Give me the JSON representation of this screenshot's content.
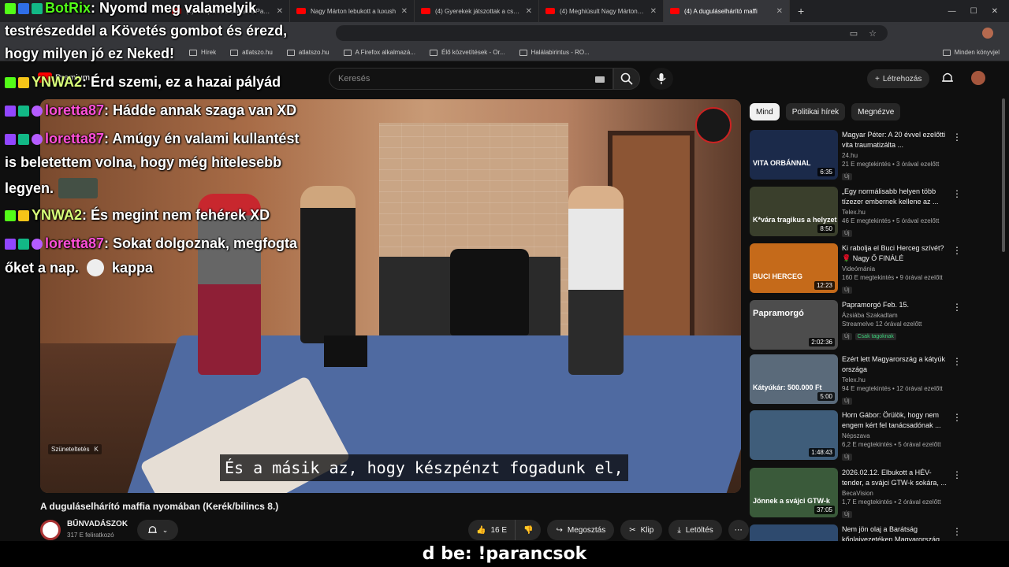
{
  "browser": {
    "tabs": [
      {
        "title": "(4) Küldj erős baloldalt a Parlam",
        "active": false
      },
      {
        "title": "Nagy Márton lebukott a luxush",
        "active": false
      },
      {
        "title": "(4) Gyerekek játszottak a csato",
        "active": false
      },
      {
        "title": "(4) Meghiúsult Nagy Márton Lu",
        "active": false
      },
      {
        "title": "(4) A duguláselhárító maffi",
        "active": true
      }
    ],
    "bookmarks": [
      "Hírek",
      "atlatszo.hu",
      "atlatszo.hu",
      "A Firefox alkalmazá...",
      "Élő közvetítések - Or...",
      "Halálabirintus - RO..."
    ],
    "bookmarks_right": "Minden könyvjel"
  },
  "youtube": {
    "logo_label": "Premium",
    "search_placeholder": "Keresés",
    "create_label": "Létrehozás"
  },
  "video": {
    "subtitle": "És a másik az, hogy készpénzt fogadunk el,",
    "pause_label": "Szüneteltetés",
    "pause_key": "K",
    "title": "A duguláselhárító maffia nyomában (Kerék/bilincs 8.)",
    "channel": "BŰNVADÁSZOK",
    "subscribers": "317 E feliratkozó",
    "likes": "16 E",
    "share_label": "Megosztás",
    "clip_label": "Klip",
    "download_label": "Letöltés"
  },
  "chips": [
    "Mind",
    "Politikai hírek",
    "Megnézve"
  ],
  "recommendations": [
    {
      "title": "Magyar Péter: A 20 évvel ezelőtti vita traumatizálta ...",
      "channel": "24.hu",
      "meta": "21 E megtekintés • 3 órával ezelőtt",
      "badge": "Új",
      "duration": "6:35",
      "thumb_text": "VITA ORBÁNNAL",
      "thumb_color": "#1b2a4a"
    },
    {
      "title": "„Egy normálisabb helyen több tízezer embernek kellene az ...",
      "channel": "Telex.hu",
      "meta": "46 E megtekintés • 5 órával ezelőtt",
      "badge": "Új",
      "duration": "8:50",
      "thumb_text": "K*vára tragikus a helyzet",
      "thumb_color": "#3a3f2c"
    },
    {
      "title": "Ki rabolja el Buci Herceg szívét? 🌹 Nagy Ő FINÁLÉ",
      "channel": "Videómánia",
      "meta": "160 E megtekintés • 9 órával ezelőtt",
      "badge": "Új",
      "duration": "12:23",
      "thumb_text": "BUCI HERCEG",
      "thumb_color": "#c56a1a"
    },
    {
      "title": "Papramorgó Feb. 15.",
      "channel": "Ázsiába Szakadtam",
      "meta": "Streamelve 12 órával ezelőtt",
      "badge": "Új",
      "badge_extra": "Csak tagoknak",
      "duration": "2:02:36",
      "thumb_text": "Papramorgó",
      "thumb_color": "#4d4d4d"
    },
    {
      "title": "Ezért lett Magyarország a kátyúk országa",
      "channel": "Telex.hu",
      "meta": "94 E megtekintés • 12 órával ezelőtt",
      "badge": "Új",
      "duration": "5:00",
      "thumb_text": "Kátyúkár: 500.000 Ft",
      "thumb_color": "#5a6a7a"
    },
    {
      "title": "Horn Gábor: Örülök, hogy nem engem kért fel tanácsadónak ...",
      "channel": "Népszava",
      "meta": "6,2 E megtekintés • 5 órával ezelőtt",
      "badge": "Új",
      "duration": "1:48:43",
      "thumb_text": "",
      "thumb_color": "#3f5d7a"
    },
    {
      "title": "2026.02.12. Elbukott a HÉV-tender, a svájci GTW-k sokára, ...",
      "channel": "BecaVision",
      "meta": "1,7 E megtekintés • 2 órával ezelőtt",
      "badge": "Új",
      "duration": "37:05",
      "thumb_text": "Jönnek a svájci GTW-k",
      "thumb_color": "#3a5a3a"
    },
    {
      "title": "Nem jön olaj a Barátság kőolajvezetéken Magyarország ...",
      "channel": "",
      "meta": "",
      "badge": "",
      "duration": "",
      "thumb_text": "",
      "thumb_color": "#2e4a6e"
    }
  ],
  "chat": [
    {
      "user": "BotRix",
      "text": ": Nyomd meg valamelyik",
      "cont": [
        "testrészeddel a Követés gombot és érezd,",
        "hogy milyen jó ez Neked!"
      ]
    },
    {
      "user": "YNWA2",
      "text": ": Érd szemi, ez a hazai pályád"
    },
    {
      "user": "loretta87",
      "text": ": Hádde annak szaga van XD"
    },
    {
      "user": "loretta87",
      "text": ": Amúgy én valami kullantést",
      "cont": [
        "is beletettem volna, hogy még hitelesebb",
        "legyen."
      ]
    },
    {
      "user": "YNWA2",
      "text": ": És megint nem fehérek XD"
    },
    {
      "user": "loretta87",
      "text": ": Sokat dolgoznak, megfogta",
      "cont_pre": "őket a nap.",
      "cont_post": "kappa"
    }
  ],
  "bottom_caption": "d be: !parancsok",
  "colors": {
    "kick_green": "#53fc18",
    "twitch_purple": "#9146ff",
    "yt_red": "#ff0000",
    "bg": "#0f0f0f"
  }
}
